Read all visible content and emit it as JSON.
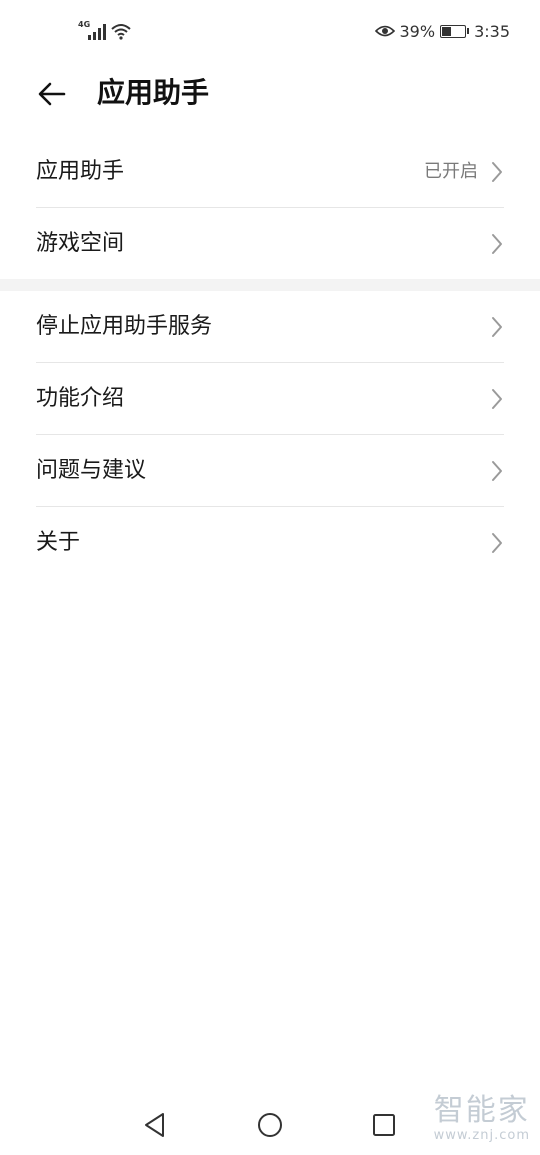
{
  "status_bar": {
    "network_type": "4G",
    "battery_percent": "39%",
    "battery_level": 0.39,
    "time": "3:35",
    "icons": [
      "signal-icon",
      "wifi-icon",
      "eye-comfort-icon",
      "battery-icon"
    ]
  },
  "header": {
    "title": "应用助手",
    "back_icon": "back-arrow-icon"
  },
  "group1": {
    "items": [
      {
        "label": "应用助手",
        "value": "已开启"
      },
      {
        "label": "游戏空间",
        "value": ""
      }
    ]
  },
  "group2": {
    "items": [
      {
        "label": "停止应用助手服务"
      },
      {
        "label": "功能介绍"
      },
      {
        "label": "问题与建议"
      },
      {
        "label": "关于"
      }
    ]
  },
  "navbar": {
    "icons": [
      "nav-back-icon",
      "nav-home-icon",
      "nav-recent-icon"
    ]
  },
  "watermark": {
    "main": "智能家",
    "sub": "www.znj.com"
  },
  "colors": {
    "background": "#ffffff",
    "text": "#1a1a1a",
    "secondary_text": "#7a7a7a",
    "divider": "#e6e6e6",
    "section_gap": "#f3f3f3"
  }
}
